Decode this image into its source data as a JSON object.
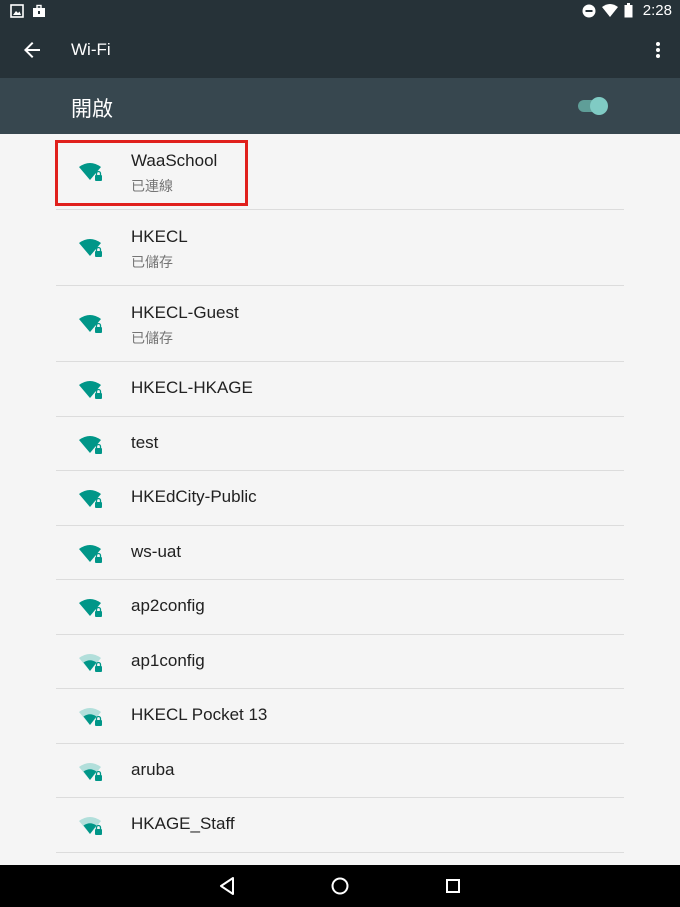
{
  "status_bar": {
    "time": "2:28",
    "left_icons": [
      "image-icon",
      "briefcase-icon"
    ],
    "right_icons": [
      "do-not-disturb-icon",
      "wifi-signal-icon",
      "battery-icon"
    ]
  },
  "app_bar": {
    "title": "Wi-Fi",
    "back_icon": "arrow-back-icon",
    "menu_icon": "more-vert-icon"
  },
  "switch_bar": {
    "label": "開啟",
    "enabled": true
  },
  "networks": [
    {
      "name": "WaaSchool",
      "status": "已連線",
      "signal": "full",
      "secured": true,
      "highlighted": true
    },
    {
      "name": "HKECL",
      "status": "已儲存",
      "signal": "full",
      "secured": true
    },
    {
      "name": "HKECL-Guest",
      "status": "已儲存",
      "signal": "full",
      "secured": true
    },
    {
      "name": "HKECL-HKAGE",
      "status": "",
      "signal": "full",
      "secured": true
    },
    {
      "name": "test",
      "status": "",
      "signal": "full",
      "secured": true
    },
    {
      "name": "HKEdCity-Public",
      "status": "",
      "signal": "full",
      "secured": true
    },
    {
      "name": "ws-uat",
      "status": "",
      "signal": "full",
      "secured": true
    },
    {
      "name": "ap2config",
      "status": "",
      "signal": "full",
      "secured": true
    },
    {
      "name": "ap1config",
      "status": "",
      "signal": "medium",
      "secured": true
    },
    {
      "name": "HKECL Pocket 13",
      "status": "",
      "signal": "medium",
      "secured": true
    },
    {
      "name": "aruba",
      "status": "",
      "signal": "medium",
      "secured": true
    },
    {
      "name": "HKAGE_Staff",
      "status": "",
      "signal": "medium",
      "secured": true
    }
  ],
  "nav_bar": {
    "buttons": [
      "back-nav-icon",
      "home-nav-icon",
      "recents-nav-icon"
    ]
  },
  "colors": {
    "status_bar": "#263238",
    "app_bar": "#263238",
    "switch_bar": "#37474f",
    "accent": "#009688",
    "highlight_box": "#e0201c"
  }
}
